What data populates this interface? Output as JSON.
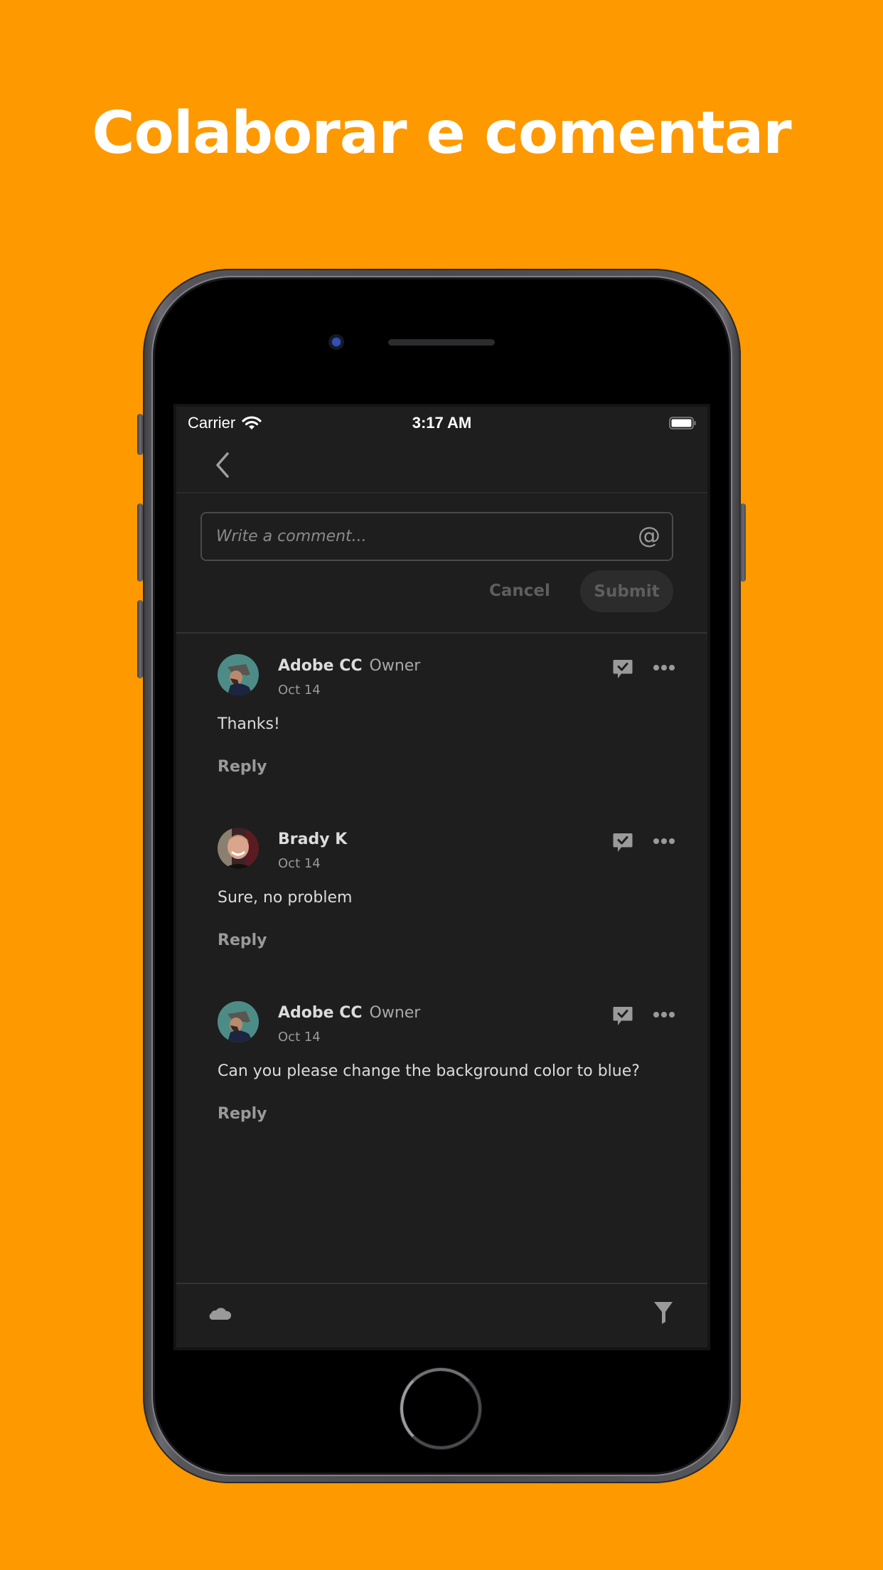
{
  "headline": "Colaborar e comentar",
  "colors": {
    "background": "#FF9900",
    "screen": "#1E1E1E",
    "text_primary": "#DCDCDC",
    "text_secondary": "#999999"
  },
  "status_bar": {
    "carrier": "Carrier",
    "time": "3:17 AM",
    "wifi_icon": "wifi-icon",
    "battery_icon": "battery-full-icon"
  },
  "nav": {
    "back_icon": "chevron-left-icon"
  },
  "composer": {
    "placeholder": "Write a comment...",
    "mention_icon": "@",
    "cancel_label": "Cancel",
    "submit_label": "Submit"
  },
  "comments": [
    {
      "author": "Adobe CC",
      "role": "Owner",
      "date": "Oct 14",
      "text": "Thanks!",
      "reply_label": "Reply"
    },
    {
      "author": "Brady K",
      "role": "",
      "date": "Oct 14",
      "text": "Sure, no problem",
      "reply_label": "Reply"
    },
    {
      "author": "Adobe CC",
      "role": "Owner",
      "date": "Oct 14",
      "text": "Can you please change the background color to blue?",
      "reply_label": "Reply"
    }
  ],
  "toolbar": {
    "left_icon": "cloud-icon",
    "right_icon": "filter-icon"
  }
}
